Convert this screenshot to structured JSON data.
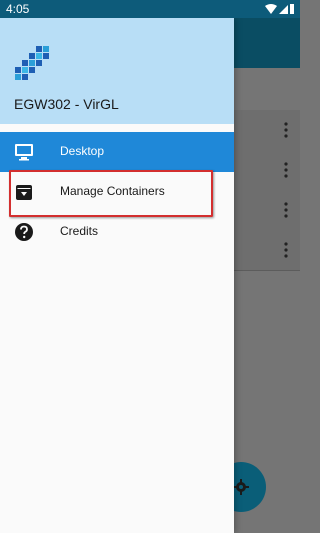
{
  "status_bar": {
    "time": "4:05"
  },
  "drawer": {
    "title": "EGW302 - VirGL",
    "items": [
      {
        "label": "Desktop",
        "icon": "monitor-icon",
        "selected": true
      },
      {
        "label": "Manage Containers",
        "icon": "archive-box-icon",
        "selected": false
      },
      {
        "label": "Credits",
        "icon": "help-circle-icon",
        "selected": false
      }
    ]
  },
  "colors": {
    "status_bar": "#0d5b7a",
    "drawer_header": "#b8def6",
    "selected_item": "#1f88d8",
    "highlight": "#d32f2f",
    "fab": "#0a5e78"
  }
}
